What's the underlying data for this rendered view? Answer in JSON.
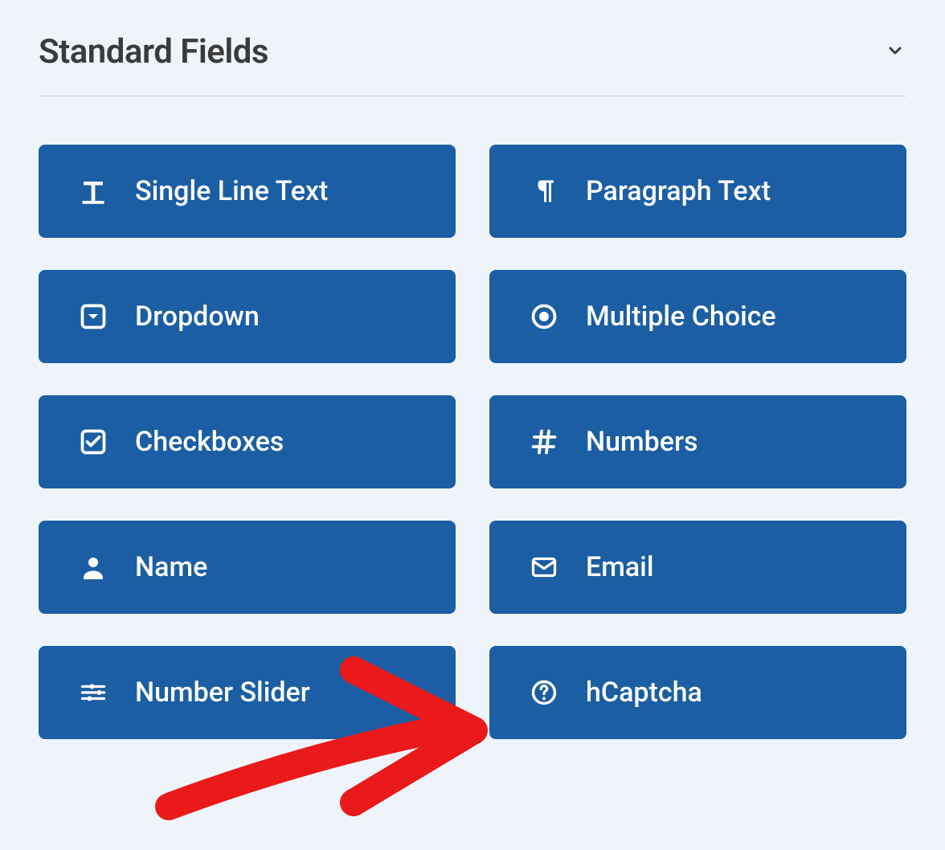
{
  "section": {
    "title": "Standard Fields"
  },
  "fields": [
    {
      "label": "Single Line Text",
      "icon": "text-cursor-icon"
    },
    {
      "label": "Paragraph Text",
      "icon": "paragraph-icon"
    },
    {
      "label": "Dropdown",
      "icon": "dropdown-icon"
    },
    {
      "label": "Multiple Choice",
      "icon": "radio-icon"
    },
    {
      "label": "Checkboxes",
      "icon": "checkbox-icon"
    },
    {
      "label": "Numbers",
      "icon": "hash-icon"
    },
    {
      "label": "Name",
      "icon": "person-icon"
    },
    {
      "label": "Email",
      "icon": "envelope-icon"
    },
    {
      "label": "Number Slider",
      "icon": "sliders-icon"
    },
    {
      "label": "hCaptcha",
      "icon": "question-circle-icon"
    }
  ],
  "colors": {
    "button_bg": "#1b5ea3",
    "page_bg": "#eef4fa",
    "text_dark": "#3b3b3b",
    "annotation": "#ea1a1a"
  }
}
